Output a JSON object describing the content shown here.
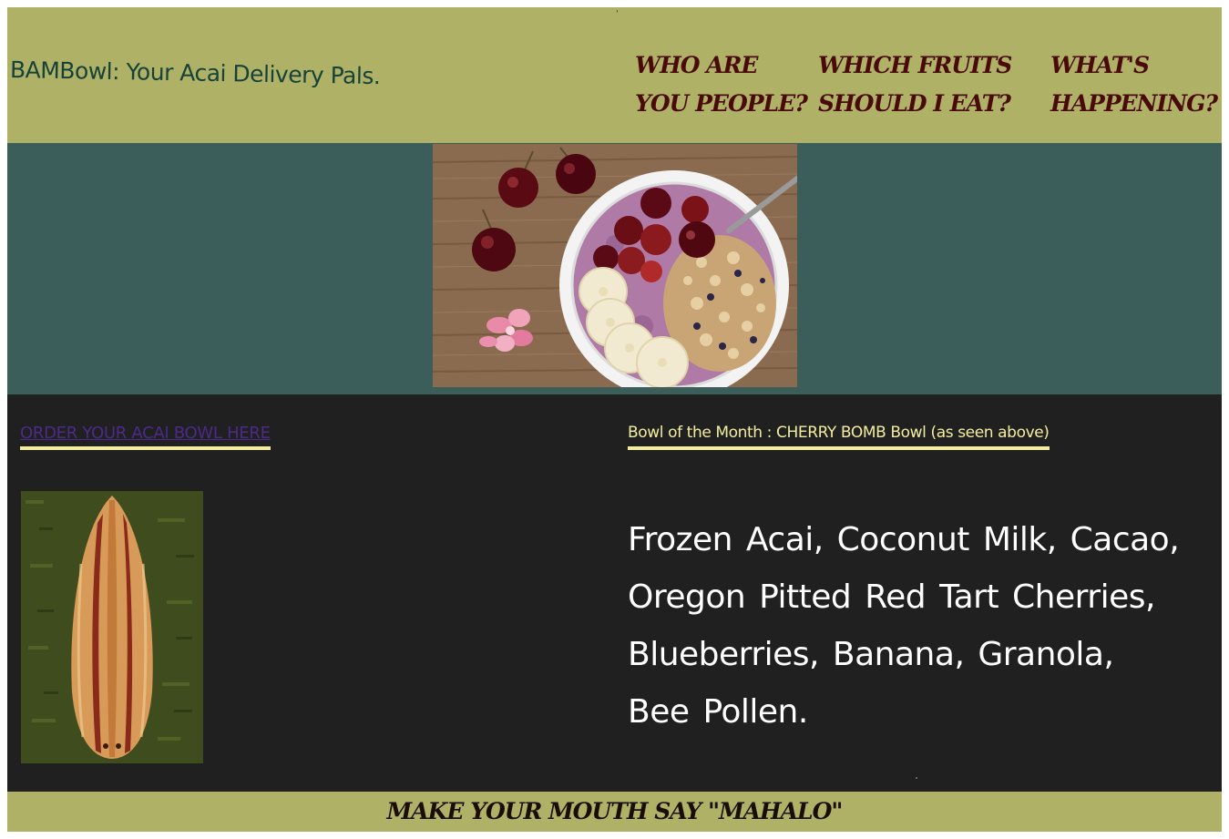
{
  "header": {
    "brand": "BAMBowl: Your Acai Delivery Pals.",
    "tick": "'",
    "nav": [
      {
        "label": "WHO ARE\nYOU PEOPLE?"
      },
      {
        "label": "WHICH FRUITS\nSHOULD I EAT?"
      },
      {
        "label": "WHAT'S\nHAPPENING?"
      }
    ]
  },
  "hero": {
    "image": "acai-bowl-photo"
  },
  "content": {
    "order_link": "ORDER YOUR ACAI BOWL HERE",
    "surfboard_image": "surfboard-photo",
    "bowl_title": "Bowl of the Month : CHERRY BOMB Bowl (as seen above)",
    "ingredients": "Frozen Acai, Coconut Milk, Cacao, Oregon Pitted Red Tart Cherries, Blueberries, Banana, Granola, Bee Pollen."
  },
  "footer": {
    "text": "MAKE YOUR MOUTH SAY \"MAHALO\""
  },
  "colors": {
    "header_bg": "#afb266",
    "hero_bg": "#3c5e5b",
    "content_bg": "#202020",
    "nav_text": "#4a0a0a",
    "brand_text": "#17423a",
    "accent_yellow": "#f2eda1",
    "link_purple": "#4b2a8a"
  }
}
